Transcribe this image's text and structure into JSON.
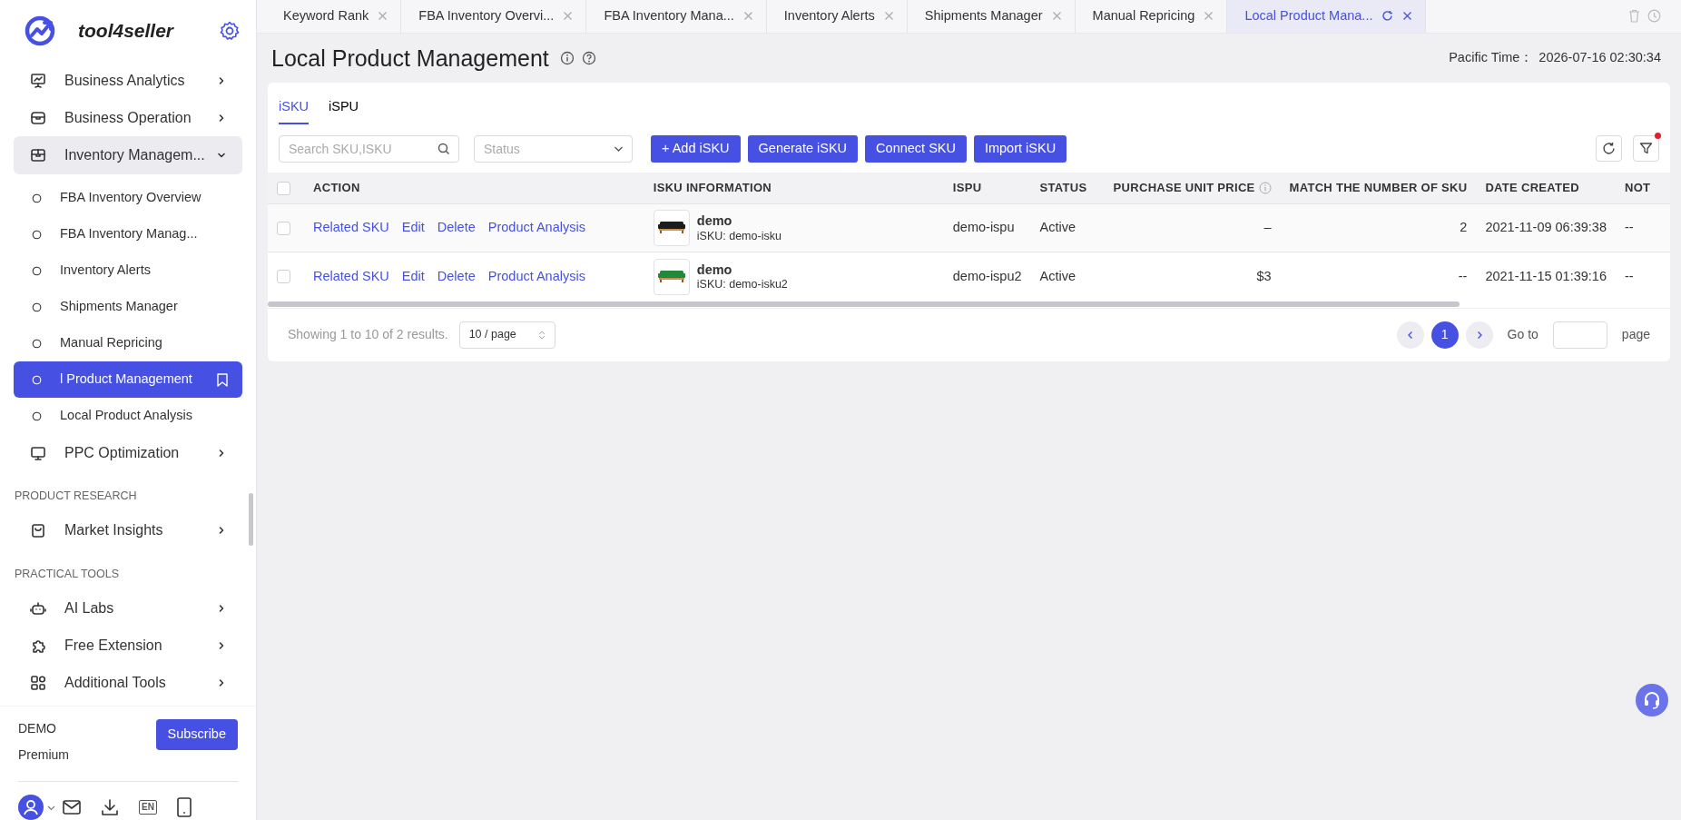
{
  "sidebar": {
    "logo": "tool4seller",
    "items": [
      {
        "kind": "menu",
        "label": "Business Analytics",
        "expanded": false,
        "selected": false
      },
      {
        "kind": "menu",
        "label": "Business Operation",
        "expanded": false,
        "selected": false
      },
      {
        "kind": "menu",
        "label": "Inventory Managem...",
        "expanded": true,
        "selected": true,
        "children": [
          {
            "label": "FBA Inventory Overview",
            "selected": false,
            "pinned": false
          },
          {
            "label": "FBA Inventory Manag...",
            "selected": false,
            "pinned": false
          },
          {
            "label": "Inventory Alerts",
            "selected": false,
            "pinned": false
          },
          {
            "label": "Shipments Manager",
            "selected": false,
            "pinned": false
          },
          {
            "label": "Manual Repricing",
            "selected": false,
            "pinned": false
          },
          {
            "label": "l Product Management",
            "selected": true,
            "pinned": true
          },
          {
            "label": "Local Product Analysis",
            "selected": false,
            "pinned": false
          }
        ]
      },
      {
        "kind": "menu",
        "label": "PPC Optimization",
        "expanded": false,
        "selected": false
      },
      {
        "kind": "section",
        "label": "PRODUCT RESEARCH"
      },
      {
        "kind": "menu",
        "label": "Market Insights",
        "expanded": false,
        "selected": false
      },
      {
        "kind": "section",
        "label": "PRACTICAL TOOLS"
      },
      {
        "kind": "menu",
        "label": "AI Labs",
        "expanded": false,
        "selected": false
      },
      {
        "kind": "menu",
        "label": "Free Extension",
        "expanded": false,
        "selected": false
      },
      {
        "kind": "menu",
        "label": "Additional Tools",
        "expanded": false,
        "selected": false
      }
    ],
    "account": {
      "name": "DEMO",
      "plan": "Premium",
      "button": "Subscribe"
    },
    "footer_icons": [
      {
        "kind": "avatar"
      },
      {
        "kind": "mail"
      },
      {
        "kind": "download"
      },
      {
        "kind": "language",
        "label": "EN"
      },
      {
        "kind": "phone"
      }
    ]
  },
  "tabs": [
    {
      "label": "Keyword Rank",
      "selected": false
    },
    {
      "label": "FBA Inventory Overvi...",
      "selected": false
    },
    {
      "label": "FBA Inventory Mana...",
      "selected": false
    },
    {
      "label": "Inventory Alerts",
      "selected": false
    },
    {
      "label": "Shipments Manager",
      "selected": false
    },
    {
      "label": "Manual Repricing",
      "selected": false
    },
    {
      "label": "Local Product Mana...",
      "selected": true
    }
  ],
  "page": {
    "title": "Local Product Management",
    "time_label": "Pacific Time：",
    "time": "2026-07-16 02:30:34"
  },
  "subtabs": [
    {
      "label": "iSKU",
      "selected": true
    },
    {
      "label": "iSPU",
      "selected": false
    }
  ],
  "search": {
    "placeholder": "Search SKU,ISKU"
  },
  "status_filter": {
    "placeholder": "Status"
  },
  "buttons": [
    "+ Add iSKU",
    "Generate iSKU",
    "Connect SKU",
    "Import iSKU"
  ],
  "filter_active": true,
  "table": {
    "columns": [
      {
        "label": "ACTION",
        "info": false
      },
      {
        "label": "ISKU INFORMATION",
        "info": false
      },
      {
        "label": "ISPU",
        "info": false
      },
      {
        "label": "STATUS",
        "info": false
      },
      {
        "label": "PURCHASE UNIT PRICE",
        "info": true
      },
      {
        "label": "MATCH THE NUMBER OF SKU",
        "info": false
      },
      {
        "label": "DATE CREATED",
        "info": false
      },
      {
        "label": "NOT",
        "info": false
      }
    ],
    "select_all": false,
    "rows": [
      {
        "selected": false,
        "actions": [
          "Related SKU",
          "Edit",
          "Delete",
          "Product Analysis"
        ],
        "name": "demo",
        "isku": "iSKU: demo-isku",
        "ispu": "demo-ispu",
        "status": "Active",
        "price": "–",
        "match": "2",
        "date": "2021-11-09 06:39:38",
        "column_8": "--"
      },
      {
        "selected": false,
        "actions": [
          "Related SKU",
          "Edit",
          "Delete",
          "Product Analysis"
        ],
        "name": "demo",
        "isku": "iSKU: demo-isku2",
        "ispu": "demo-ispu2",
        "status": "Active",
        "price": "$3",
        "match": "--",
        "date": "2021-11-15 01:39:16",
        "column_8": "--"
      }
    ]
  },
  "pagination": {
    "summary": "Showing 1 to 10 of 2 results.",
    "page_size": "10 / page",
    "pages": [
      {
        "label": "1",
        "selected": true
      }
    ],
    "goto_label": "Go to",
    "page_label": "page"
  }
}
